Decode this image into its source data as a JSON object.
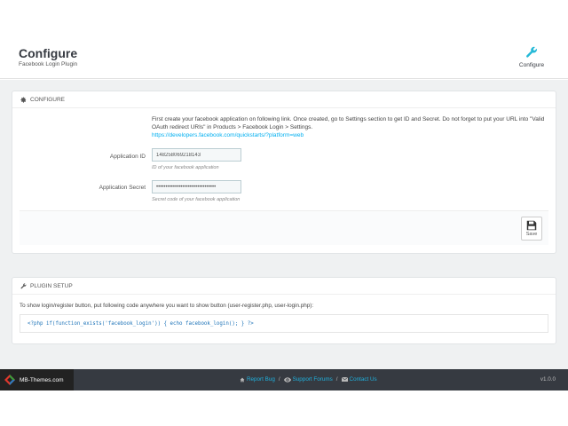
{
  "header": {
    "title": "Configure",
    "subtitle": "Facebook Login Plugin",
    "toolbar": {
      "configure_label": "Configure"
    }
  },
  "configure_panel": {
    "heading": "CONFIGURE",
    "intro_text": "First create your facebook application on following link. Once created, go to Settings section to get ID and Secret. Do not forget to put your URL into \"Valid OAuth redirect URIs\" in Products > Facebook Login > Settings.",
    "intro_link": "https://developers.facebook.com/quickstarts/?platform=web",
    "app_id": {
      "label": "Application ID",
      "value": "148258069218143",
      "help": "ID of your facebook application"
    },
    "app_secret": {
      "label": "Application Secret",
      "value": "••••••••••••••••••••••••••••••••",
      "help": "Secret code of your facebook application"
    },
    "save_label": "Save"
  },
  "plugin_setup_panel": {
    "heading": "PLUGIN SETUP",
    "intro": "To show login/register button, put following code anywhere you want to show button (user-register.php, user-login.php):",
    "code": "<?php if(function_exists('facebook_login')) { echo facebook_login(); } ?>"
  },
  "footer": {
    "brand": "MB-Themes.com",
    "links": [
      {
        "label": "Report Bug",
        "icon": "home-icon"
      },
      {
        "label": "Support Forums",
        "icon": "eye-icon"
      },
      {
        "label": "Contact Us",
        "icon": "envelope-icon"
      }
    ],
    "separator": "/",
    "version": "v1.0.0"
  },
  "colors": {
    "accent": "#00aff0",
    "footer_bg": "#363a41",
    "content_bg": "#eff1f2"
  }
}
